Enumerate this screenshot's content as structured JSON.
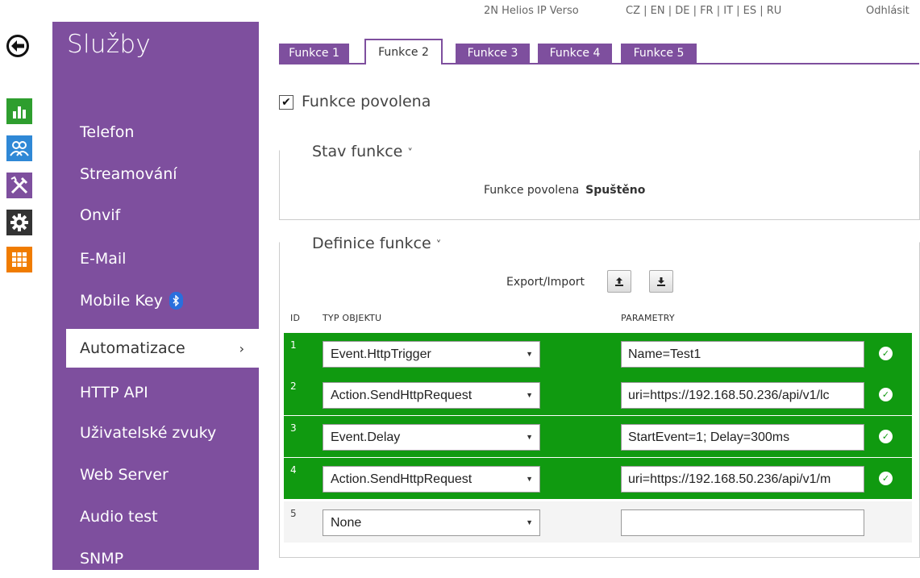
{
  "topbar": {
    "device": "2N Helios IP Verso",
    "languages": "CZ | EN | DE | FR | IT | ES | RU",
    "logout": "Odhlásit"
  },
  "sidebar": {
    "title": "Služby",
    "items": [
      {
        "label": "Telefon"
      },
      {
        "label": "Streamování"
      },
      {
        "label": "Onvif"
      },
      {
        "label": "E-Mail"
      },
      {
        "label": "Mobile Key"
      },
      {
        "label": "Automatizace",
        "active": true
      },
      {
        "label": "HTTP API"
      },
      {
        "label": "Uživatelské zvuky"
      },
      {
        "label": "Web Server"
      },
      {
        "label": "Audio test"
      },
      {
        "label": "SNMP"
      }
    ]
  },
  "rail": {
    "icons": [
      "back-arrow-icon",
      "bar-chart-icon",
      "users-icon",
      "tools-icon",
      "gear-icon",
      "grid-icon"
    ],
    "colors": {
      "green": "#2e9e2e",
      "blue": "#2f88d6",
      "purple": "#7e4f9e",
      "dark": "#333333",
      "orange": "#f07c00"
    }
  },
  "tabs": [
    {
      "label": "Funkce 1"
    },
    {
      "label": "Funkce 2",
      "active": true
    },
    {
      "label": "Funkce 3"
    },
    {
      "label": "Funkce 4"
    },
    {
      "label": "Funkce 5"
    }
  ],
  "enabled": {
    "label": "Funkce povolena",
    "checked": true
  },
  "stav": {
    "title": "Stav funkce",
    "label": "Funkce povolena",
    "value": "Spuštěno"
  },
  "definice": {
    "title": "Definice funkce",
    "export_import": "Export/Import",
    "col_id": "ID",
    "col_type": "TYP OBJEKTU",
    "col_params": "PARAMETRY",
    "rows": [
      {
        "id": "1",
        "type": "Event.HttpTrigger",
        "params": "Name=Test1",
        "ok": true
      },
      {
        "id": "2",
        "type": "Action.SendHttpRequest",
        "params": "uri=https://192.168.50.236/api/v1/lc",
        "ok": true
      },
      {
        "id": "3",
        "type": "Event.Delay",
        "params": "StartEvent=1; Delay=300ms",
        "ok": true
      },
      {
        "id": "4",
        "type": "Action.SendHttpRequest",
        "params": "uri=https://192.168.50.236/api/v1/m",
        "ok": true
      },
      {
        "id": "5",
        "type": "None",
        "params": "",
        "ok": false
      }
    ]
  },
  "colors": {
    "accent": "#7e4f9e",
    "ok": "#109a10"
  }
}
